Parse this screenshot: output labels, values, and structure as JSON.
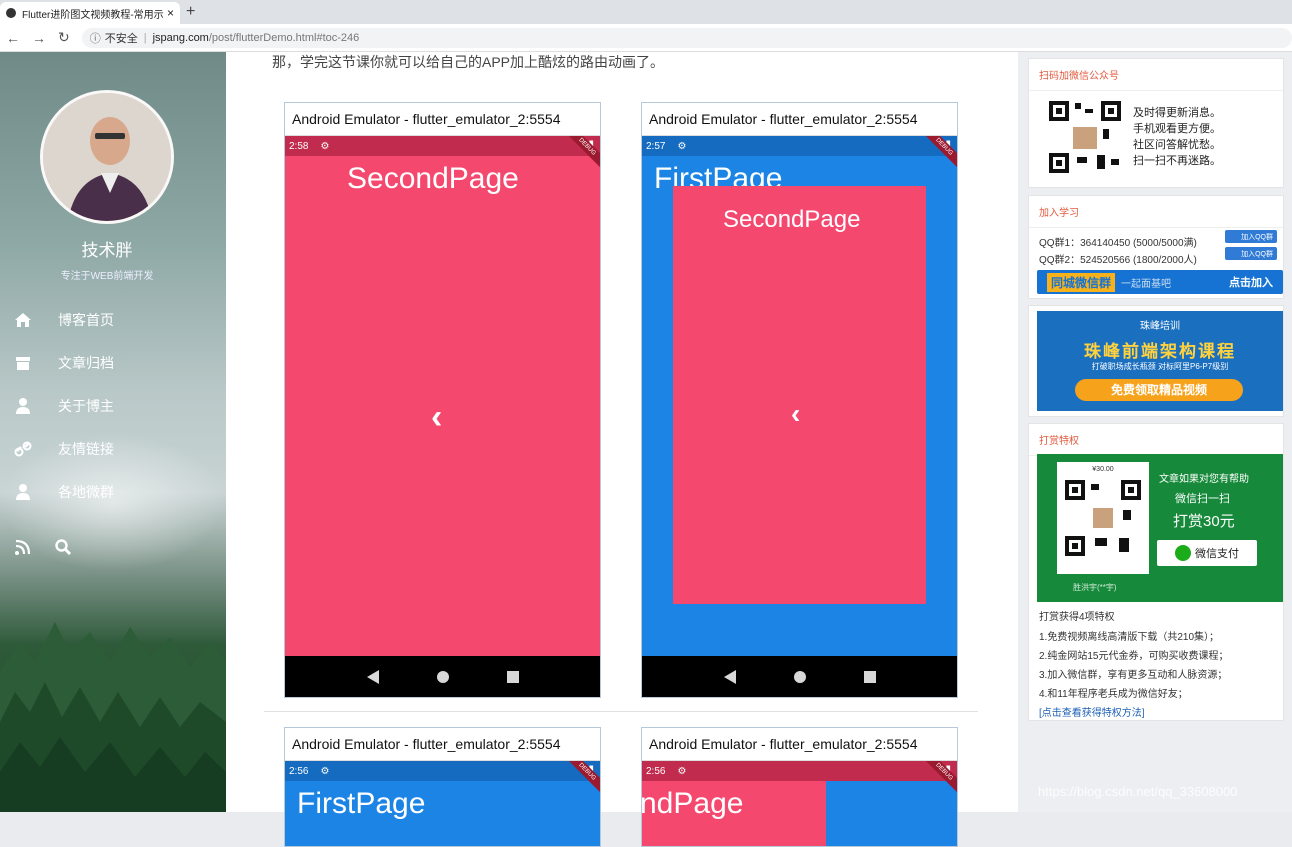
{
  "browser": {
    "tab_title": "Flutter进阶图文视频教程-常用示",
    "tab_close": "×",
    "new_tab": "+",
    "security_label": "不安全",
    "url_domain": "jspang.com",
    "url_path": "/post/flutterDemo.html#toc-246"
  },
  "sidebar": {
    "blogger_name": "技术胖",
    "tagline": "专注于WEB前端开发",
    "menu": [
      {
        "label": "博客首页",
        "icon": "home-icon"
      },
      {
        "label": "文章归档",
        "icon": "archive-icon"
      },
      {
        "label": "关于博主",
        "icon": "user-icon"
      },
      {
        "label": "友情链接",
        "icon": "link-icon"
      },
      {
        "label": "各地微群",
        "icon": "user-icon"
      }
    ]
  },
  "article": {
    "intro": "那，学完这节课你就可以给自己的APP加上酷炫的路由动画了。",
    "emulator_title": "Android Emulator - flutter_emulator_2:5554",
    "emulators": [
      {
        "time": "2:58",
        "title": "SecondPage"
      },
      {
        "time": "2:57",
        "title": "FirstPage",
        "inner_title": "SecondPage"
      },
      {
        "time": "2:56",
        "title": "FirstPage"
      },
      {
        "time": "2:56",
        "title": "ndPage"
      }
    ],
    "debug_label": "DEBUG",
    "back_glyph": "‹"
  },
  "right": {
    "wechat_head": "扫码加微信公众号",
    "wechat_lines": [
      "及时得更新消息。",
      "手机观看更方便。",
      "社区问答解忧愁。",
      "扫一扫不再迷路。"
    ],
    "join_head": "加入学习",
    "qq1": "QQ群1：364140450 (5000/5000满)",
    "qq2": "QQ群2：524520566 (1800/2000人)",
    "qq_btn": "加入QQ群",
    "wx_group": "同城微信群",
    "wx_sub": "一起面基吧",
    "wx_join": "点击加入",
    "ad_logo": "珠峰培训",
    "ad_title": "珠峰前端架构课程",
    "ad_sub": "打破职场成长瓶颈 对标阿里P6-P7级别",
    "ad_btn": "免费领取精品视频",
    "reward_head": "打赏特权",
    "reward_price": "¥30.00",
    "reward_t1": "文章如果对您有帮助",
    "reward_t2": "微信扫一扫",
    "reward_t3": "打赏30元",
    "reward_pay": "微信支付",
    "reward_name": "胜洪宇(**宇)",
    "privileges": [
      "打赏获得4项特权",
      "1.免费视频离线高清版下载（共210集）；",
      "2.纯金网站15元代金券，可购买收费课程；",
      "3.加入微信群，享有更多互动和人脉资源；",
      "4.和11年程序老兵成为微信好友；"
    ],
    "privilege_link": "[点击查看获得特权方法]"
  },
  "watermark": "https://blog.csdn.net/qq_33608000"
}
